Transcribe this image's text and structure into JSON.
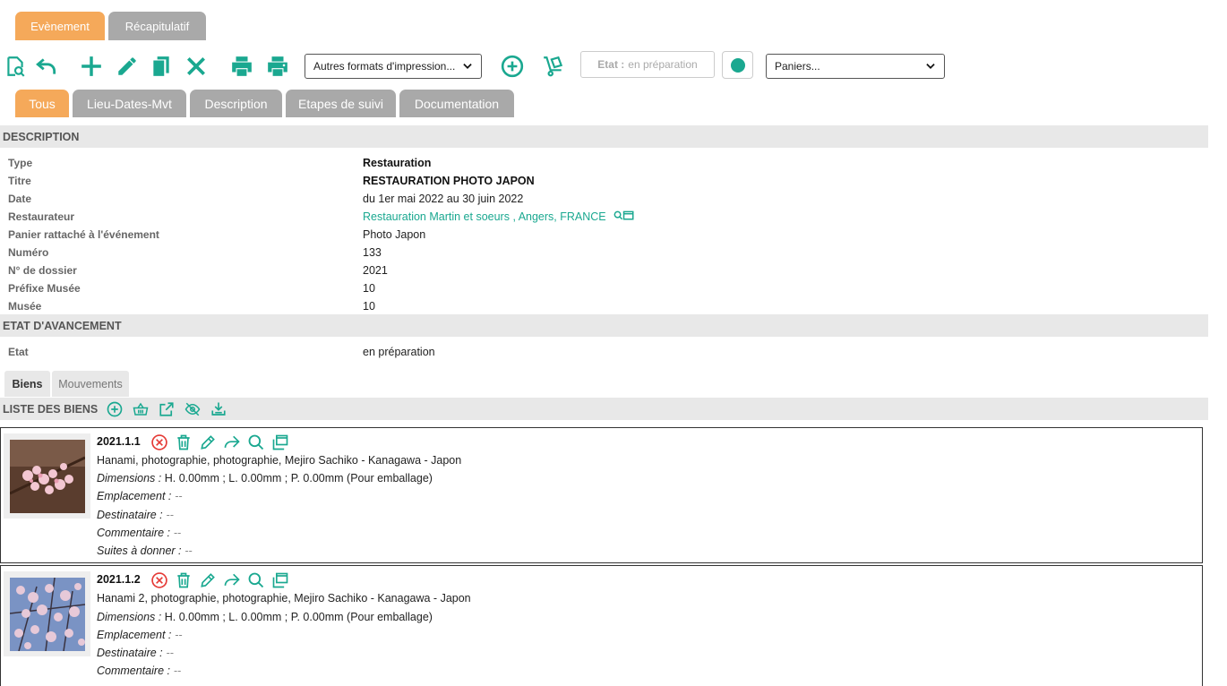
{
  "top_tabs": {
    "evenement": "Evènement",
    "recap": "Récapitulatif"
  },
  "toolbar": {
    "print_formats_select": "Autres formats d'impression...",
    "status_label": "Etat :",
    "status_value": "en préparation",
    "paniers_select": "Paniers...",
    "icons": [
      "search-document-icon",
      "undo-icon",
      "add-icon",
      "edit-icon",
      "duplicate-icon",
      "close-icon",
      "print-icon",
      "print-alt-icon",
      "add-circle-icon",
      "dolly-icon",
      "status-circle-icon"
    ]
  },
  "sub_tabs": [
    "Tous",
    "Lieu-Dates-Mvt",
    "Description",
    "Etapes de suivi",
    "Documentation"
  ],
  "description": {
    "section_title": "DESCRIPTION",
    "rows": [
      {
        "label": "Type",
        "value": "Restauration"
      },
      {
        "label": "Titre",
        "value": "RESTAURATION PHOTO JAPON"
      },
      {
        "label": "Date",
        "value": "du 1er mai 2022 au 30 juin 2022"
      },
      {
        "label": "Restaurateur",
        "value": "Restauration Martin et soeurs , Angers, FRANCE"
      },
      {
        "label": "Panier rattaché à l'événement",
        "value": "Photo Japon"
      },
      {
        "label": "Numéro",
        "value": "133"
      },
      {
        "label": "N° de dossier",
        "value": "2021"
      },
      {
        "label": "Préfixe Musée",
        "value": "10"
      },
      {
        "label": "Musée",
        "value": "10"
      }
    ]
  },
  "avancement": {
    "section_title": "ETAT D'AVANCEMENT",
    "label": "Etat",
    "value": "en préparation"
  },
  "biens_tabs": {
    "biens": "Biens",
    "mouvements": "Mouvements"
  },
  "liste": {
    "title": "LISTE DES BIENS",
    "icons": [
      "add-circle-icon",
      "basket-icon",
      "external-link-icon",
      "eye-off-icon",
      "download-icon"
    ]
  },
  "field_labels": {
    "dimensions": "Dimensions :",
    "emplacement": "Emplacement :",
    "destinataire": "Destinataire :",
    "commentaire": "Commentaire :",
    "suites": "Suites à donner :",
    "empty": "--"
  },
  "items": [
    {
      "code": "2021.1.1",
      "desc": "Hanami, photographie, photographie, Mejiro Sachiko - Kanagawa - Japon",
      "dimensions": "H. 0.00mm ; L. 0.00mm ; P. 0.00mm (Pour emballage)"
    },
    {
      "code": "2021.1.2",
      "desc": "Hanami 2, photographie, photographie, Mejiro Sachiko - Kanagawa - Japon",
      "dimensions": "H. 0.00mm ; L. 0.00mm ; P. 0.00mm (Pour emballage)"
    }
  ],
  "colors": {
    "accent": "#1aa890",
    "tab_active": "#f5a95a",
    "tab_inactive": "#a9a9a9",
    "delete": "#e53935"
  }
}
